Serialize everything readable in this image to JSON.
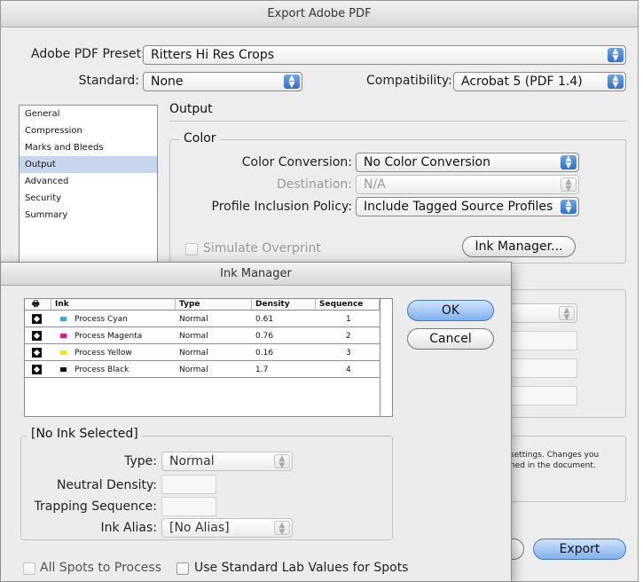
{
  "export": {
    "title": "Export Adobe PDF",
    "preset_label": "Adobe PDF Preset:",
    "preset_value": "Ritters Hi Res Crops",
    "standard_label": "Standard:",
    "standard_value": "None",
    "compat_label": "Compatibility:",
    "compat_value": "Acrobat 5 (PDF 1.4)",
    "sidebar": [
      "General",
      "Compression",
      "Marks and Bleeds",
      "Output",
      "Advanced",
      "Security",
      "Summary"
    ],
    "section_title": "Output",
    "color_group": "Color",
    "color_conversion_label": "Color Conversion:",
    "color_conversion_value": "No Color Conversion",
    "destination_label": "Destination:",
    "destination_value": "N/A",
    "profile_label": "Profile Inclusion Policy:",
    "profile_value": "Include Tagged Source Profiles",
    "simulate_label": "Simulate Overprint",
    "ink_manager_button": "Ink Manager...",
    "desc_line1": "settings. Changes you",
    "desc_line2": "ned in the document.",
    "export_button": "Export"
  },
  "ink_manager": {
    "title": "Ink Manager",
    "columns": [
      "Ink",
      "Type",
      "Density",
      "Sequence"
    ],
    "rows": [
      {
        "name": "Process Cyan",
        "type": "Normal",
        "density": "0.61",
        "sequence": "1",
        "color": "#21b6e6"
      },
      {
        "name": "Process Magenta",
        "type": "Normal",
        "density": "0.76",
        "sequence": "2",
        "color": "#e6177a"
      },
      {
        "name": "Process Yellow",
        "type": "Normal",
        "density": "0.16",
        "sequence": "3",
        "color": "#f5e800"
      },
      {
        "name": "Process Black",
        "type": "Normal",
        "density": "1.7",
        "sequence": "4",
        "color": "#111111"
      }
    ],
    "ok_button": "OK",
    "cancel_button": "Cancel",
    "group_title": "[No Ink Selected]",
    "type_label": "Type:",
    "type_value": "Normal",
    "neutral_density_label": "Neutral Density:",
    "trapping_sequence_label": "Trapping Sequence:",
    "ink_alias_label": "Ink Alias:",
    "ink_alias_value": "[No Alias]",
    "all_spots_label": "All Spots to Process",
    "standard_lab_label": "Use Standard Lab Values for Spots"
  }
}
